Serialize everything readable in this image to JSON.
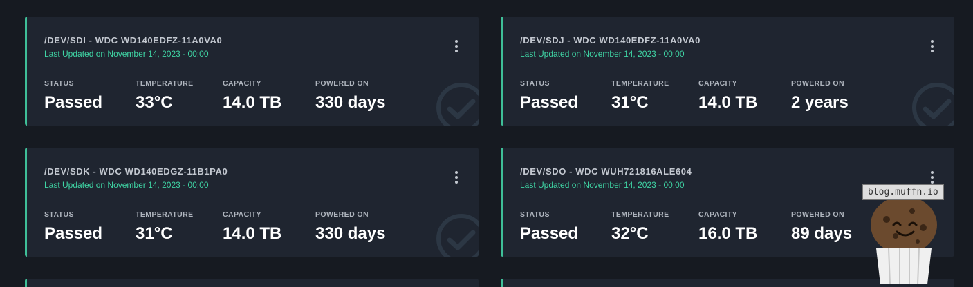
{
  "stat_labels": {
    "status": "STATUS",
    "temperature": "TEMPERATURE",
    "capacity": "CAPACITY",
    "powered_on": "POWERED ON"
  },
  "cards": [
    {
      "title": "/DEV/SDI - WDC WD140EDFZ-11A0VA0",
      "updated": "Last Updated on November 14, 2023 - 00:00",
      "status": "Passed",
      "temperature": "33°C",
      "capacity": "14.0 TB",
      "powered_on": "330 days"
    },
    {
      "title": "/DEV/SDJ - WDC WD140EDFZ-11A0VA0",
      "updated": "Last Updated on November 14, 2023 - 00:00",
      "status": "Passed",
      "temperature": "31°C",
      "capacity": "14.0 TB",
      "powered_on": "2 years"
    },
    {
      "title": "/DEV/SDK - WDC WD140EDGZ-11B1PA0",
      "updated": "Last Updated on November 14, 2023 - 00:00",
      "status": "Passed",
      "temperature": "31°C",
      "capacity": "14.0 TB",
      "powered_on": "330 days"
    },
    {
      "title": "/DEV/SDO - WDC WUH721816ALE604",
      "updated": "Last Updated on November 14, 2023 - 00:00",
      "status": "Passed",
      "temperature": "32°C",
      "capacity": "16.0 TB",
      "powered_on": "89 days"
    }
  ],
  "watermark": {
    "text": "blog.muffn.io"
  },
  "colors": {
    "accent": "#3fbf98",
    "updated_text": "#3fd4a4",
    "background": "#161a21",
    "card": "#1f2530"
  }
}
